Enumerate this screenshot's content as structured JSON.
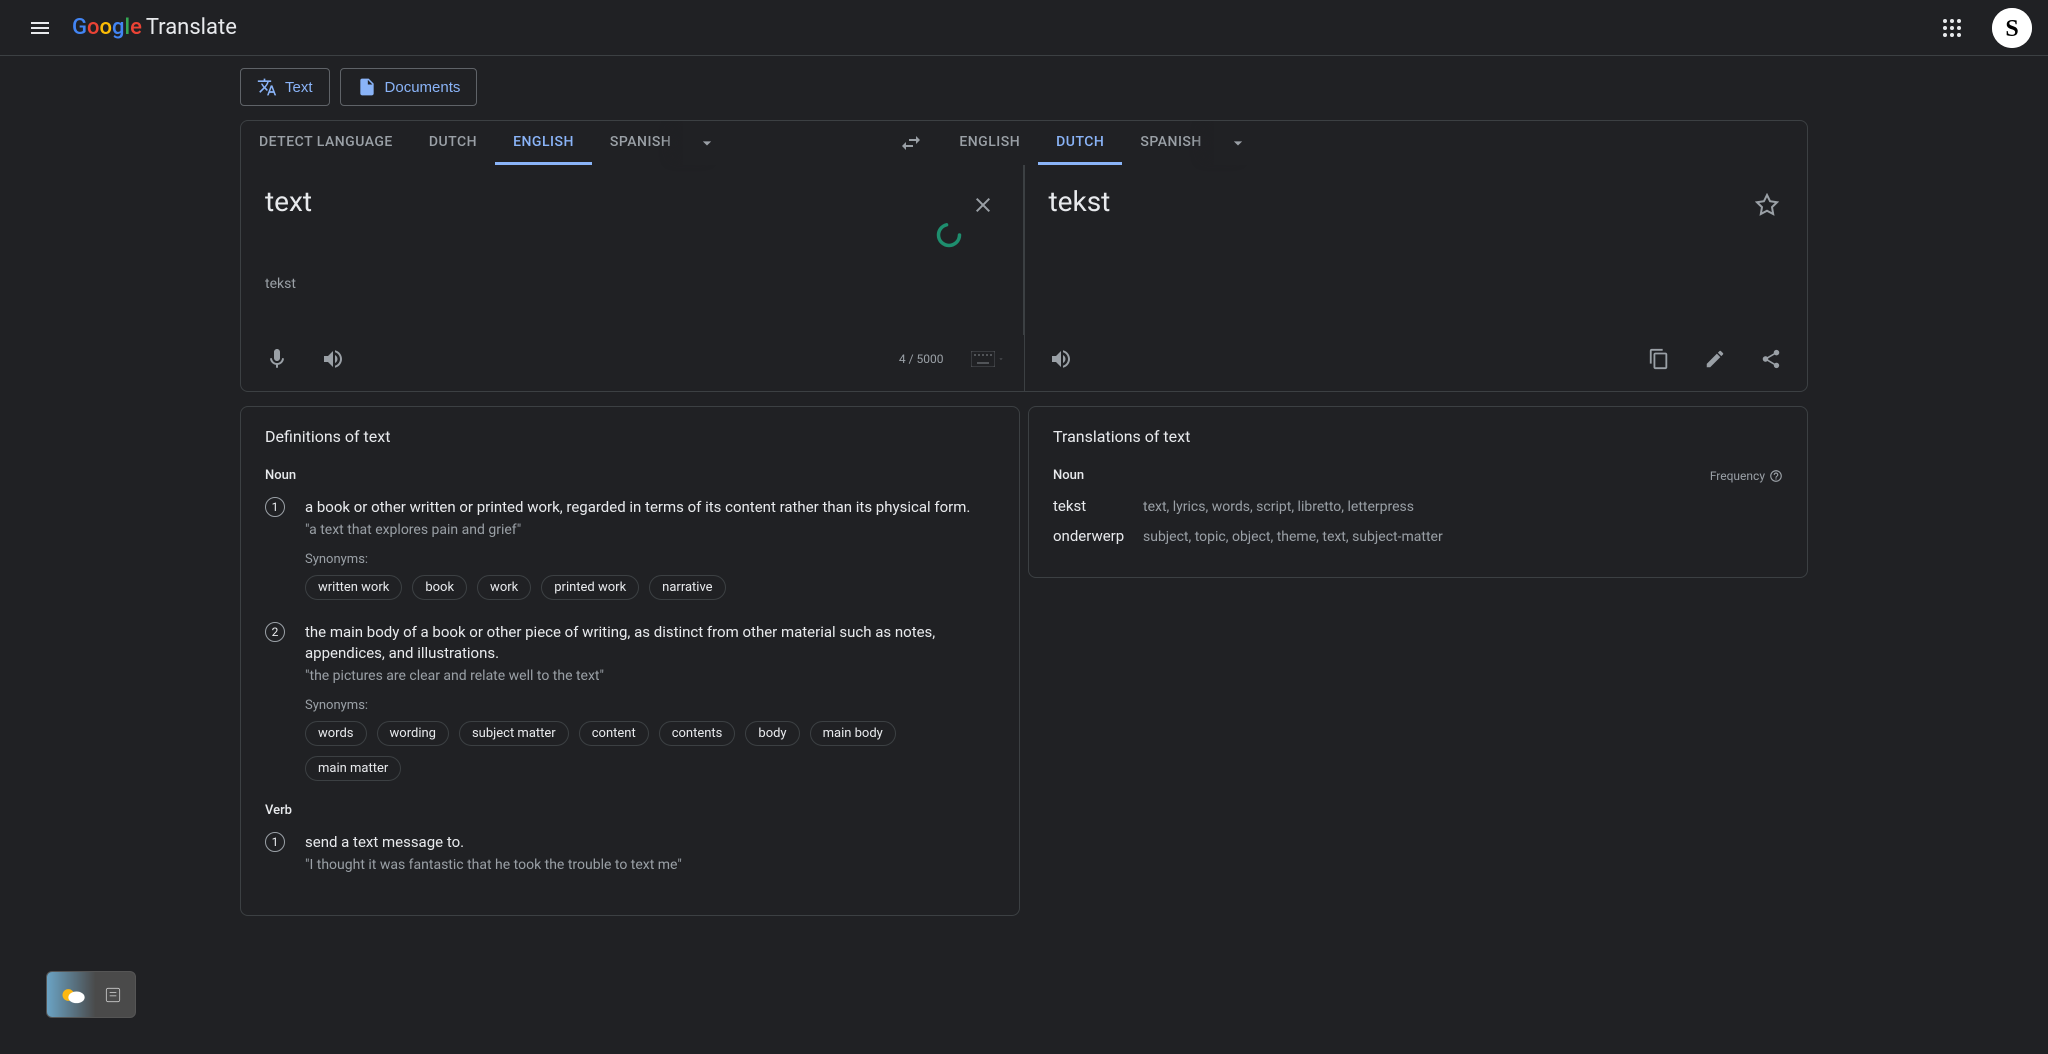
{
  "header": {
    "app_name": "Translate",
    "avatar_letter": "S"
  },
  "modes": {
    "text": "Text",
    "documents": "Documents"
  },
  "source_tabs": [
    "DETECT LANGUAGE",
    "DUTCH",
    "ENGLISH",
    "SPANISH"
  ],
  "source_active_index": 2,
  "target_tabs": [
    "ENGLISH",
    "DUTCH",
    "SPANISH"
  ],
  "target_active_index": 1,
  "input": {
    "value": "text",
    "suggestion": "tekst",
    "char_count": "4 / 5000"
  },
  "output": {
    "value": "tekst"
  },
  "definitions": {
    "title": "Definitions of text",
    "groups": [
      {
        "pos": "Noun",
        "items": [
          {
            "num": "1",
            "text": "a book or other written or printed work, regarded in terms of its content rather than its physical form.",
            "example": "\"a text that explores pain and grief\"",
            "syn_label": "Synonyms:",
            "synonyms": [
              "written work",
              "book",
              "work",
              "printed work",
              "narrative"
            ]
          },
          {
            "num": "2",
            "text": "the main body of a book or other piece of writing, as distinct from other material such as notes, appendices, and illustrations.",
            "example": "\"the pictures are clear and relate well to the text\"",
            "syn_label": "Synonyms:",
            "synonyms": [
              "words",
              "wording",
              "subject matter",
              "content",
              "contents",
              "body",
              "main body",
              "main matter"
            ]
          }
        ]
      },
      {
        "pos": "Verb",
        "items": [
          {
            "num": "1",
            "text": "send a text message to.",
            "example": "\"I thought it was fantastic that he took the trouble to text me\"",
            "syn_label": "",
            "synonyms": []
          }
        ]
      }
    ]
  },
  "translations": {
    "title": "Translations of text",
    "frequency_label": "Frequency",
    "groups": [
      {
        "pos": "Noun",
        "rows": [
          {
            "word": "tekst",
            "back": "text, lyrics, words, script, libretto, letterpress"
          },
          {
            "word": "onderwerp",
            "back": "subject, topic, object, theme, text, subject-matter"
          }
        ]
      }
    ]
  }
}
